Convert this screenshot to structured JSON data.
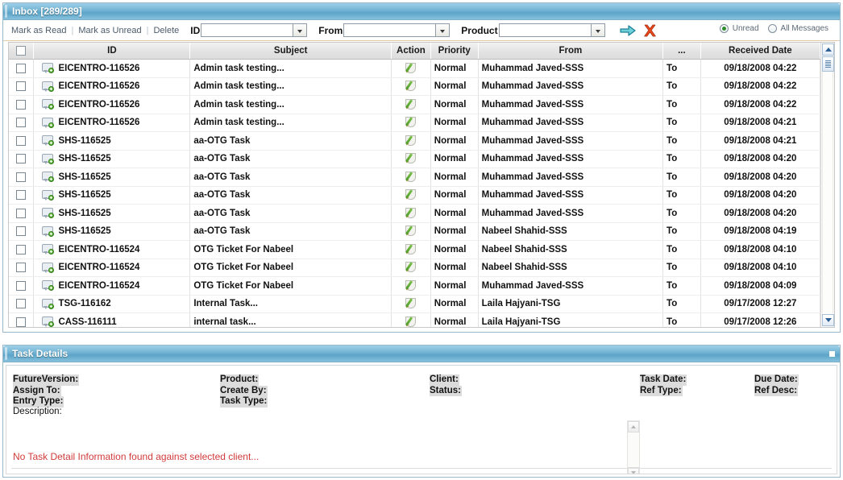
{
  "inbox": {
    "title": "Inbox [289/289]",
    "toolbar": {
      "mark_read": "Mark as Read",
      "mark_unread": "Mark as Unread",
      "delete": "Delete",
      "separator": "|",
      "id_label": "ID",
      "id_value": "",
      "from_label": "From",
      "from_value": "",
      "product_label": "Product",
      "product_value": "",
      "go_icon": "arrow-right-icon",
      "clear_icon": "red-x-icon",
      "filter_unread": "Unread",
      "filter_all": "All Messages",
      "filter_selected": "Unread"
    },
    "columns": {
      "select": "",
      "id": "ID",
      "subject": "Subject",
      "action": "Action",
      "priority": "Priority",
      "from": "From",
      "to": "...",
      "received": "Received Date"
    },
    "rows": [
      {
        "id": "EICENTRO-116526",
        "subject": "Admin task testing...",
        "priority": "Normal",
        "from": "Muhammad Javed-SSS",
        "to": "To",
        "received": "09/18/2008 04:22"
      },
      {
        "id": "EICENTRO-116526",
        "subject": "Admin task testing...",
        "priority": "Normal",
        "from": "Muhammad Javed-SSS",
        "to": "To",
        "received": "09/18/2008 04:22"
      },
      {
        "id": "EICENTRO-116526",
        "subject": "Admin task testing...",
        "priority": "Normal",
        "from": "Muhammad Javed-SSS",
        "to": "To",
        "received": "09/18/2008 04:22"
      },
      {
        "id": "EICENTRO-116526",
        "subject": "Admin task testing...",
        "priority": "Normal",
        "from": "Muhammad Javed-SSS",
        "to": "To",
        "received": "09/18/2008 04:21"
      },
      {
        "id": "SHS-116525",
        "subject": "aa-OTG Task",
        "priority": "Normal",
        "from": "Muhammad Javed-SSS",
        "to": "To",
        "received": "09/18/2008 04:21"
      },
      {
        "id": "SHS-116525",
        "subject": "aa-OTG Task",
        "priority": "Normal",
        "from": "Muhammad Javed-SSS",
        "to": "To",
        "received": "09/18/2008 04:20"
      },
      {
        "id": "SHS-116525",
        "subject": "aa-OTG Task",
        "priority": "Normal",
        "from": "Muhammad Javed-SSS",
        "to": "To",
        "received": "09/18/2008 04:20"
      },
      {
        "id": "SHS-116525",
        "subject": "aa-OTG Task",
        "priority": "Normal",
        "from": "Muhammad Javed-SSS",
        "to": "To",
        "received": "09/18/2008 04:20"
      },
      {
        "id": "SHS-116525",
        "subject": "aa-OTG Task",
        "priority": "Normal",
        "from": "Muhammad Javed-SSS",
        "to": "To",
        "received": "09/18/2008 04:20"
      },
      {
        "id": "SHS-116525",
        "subject": "aa-OTG Task",
        "priority": "Normal",
        "from": "Nabeel Shahid-SSS",
        "to": "To",
        "received": "09/18/2008 04:19"
      },
      {
        "id": "EICENTRO-116524",
        "subject": "OTG Ticket For Nabeel",
        "priority": "Normal",
        "from": "Nabeel Shahid-SSS",
        "to": "To",
        "received": "09/18/2008 04:10"
      },
      {
        "id": "EICENTRO-116524",
        "subject": "OTG Ticket For Nabeel",
        "priority": "Normal",
        "from": "Nabeel Shahid-SSS",
        "to": "To",
        "received": "09/18/2008 04:10"
      },
      {
        "id": "EICENTRO-116524",
        "subject": "OTG Ticket For Nabeel",
        "priority": "Normal",
        "from": "Muhammad Javed-SSS",
        "to": "To",
        "received": "09/18/2008 04:09"
      },
      {
        "id": "TSG-116162",
        "subject": "Internal Task...",
        "priority": "Normal",
        "from": "Laila Hajyani-TSG",
        "to": "To",
        "received": "09/17/2008 12:27"
      },
      {
        "id": "CASS-116111",
        "subject": "internal task...",
        "priority": "Normal",
        "from": "Laila Hajyani-TSG",
        "to": "To",
        "received": "09/17/2008 12:26"
      }
    ]
  },
  "details": {
    "title": "Task Details",
    "fields": {
      "future_version": "FutureVersion:",
      "assign_to": "Assign To:",
      "entry_type": "Entry Type:",
      "product": "Product:",
      "create_by": "Create By:",
      "task_type": "Task Type:",
      "client": "Client:",
      "status": "Status:",
      "task_date": "Task Date:",
      "ref_type": "Ref Type:",
      "due_date": "Due Date:",
      "ref_desc": "Ref Desc:",
      "description": "Description:"
    },
    "message": "No Task Detail Information found against selected client..."
  },
  "colors": {
    "title_bar": "#5ca4c8",
    "subject_link": "#2f5f86",
    "error_text": "#d23b3b",
    "radio_selected": "#2e8b2e"
  }
}
